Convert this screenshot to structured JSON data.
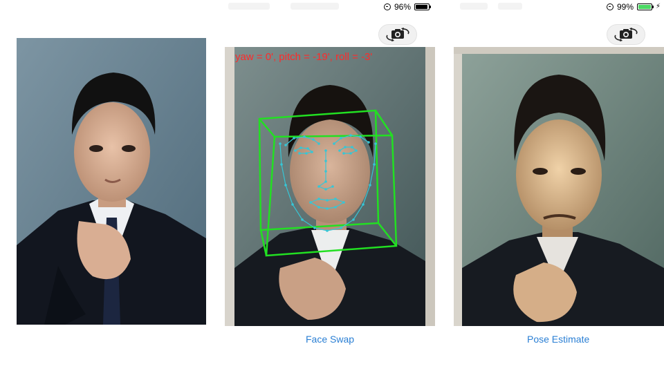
{
  "statusbars": [
    {
      "battery_text": "96%",
      "battery_level": 0.96,
      "battery_color": "#000000",
      "charging": false
    },
    {
      "battery_text": "99%",
      "battery_level": 0.99,
      "battery_color": "#4cd964",
      "charging": true
    }
  ],
  "pose_estimate": {
    "overlay_text": "yaw = 0', pitch = -19', roll = -3'",
    "overlay_color": "#ff2a2a",
    "cube_color": "#22e022",
    "landmark_color": "#36c6d6"
  },
  "tabs": {
    "face_swap": "Face Swap",
    "pose_estimate": "Pose Estimate"
  },
  "icons": {
    "camera_switch": "camera-switch-icon",
    "orientation_lock": "orientation-lock-icon",
    "battery": "battery-icon",
    "charging": "charging-bolt-icon"
  },
  "colors": {
    "link": "#2a7fd4",
    "background": "#ffffff"
  }
}
